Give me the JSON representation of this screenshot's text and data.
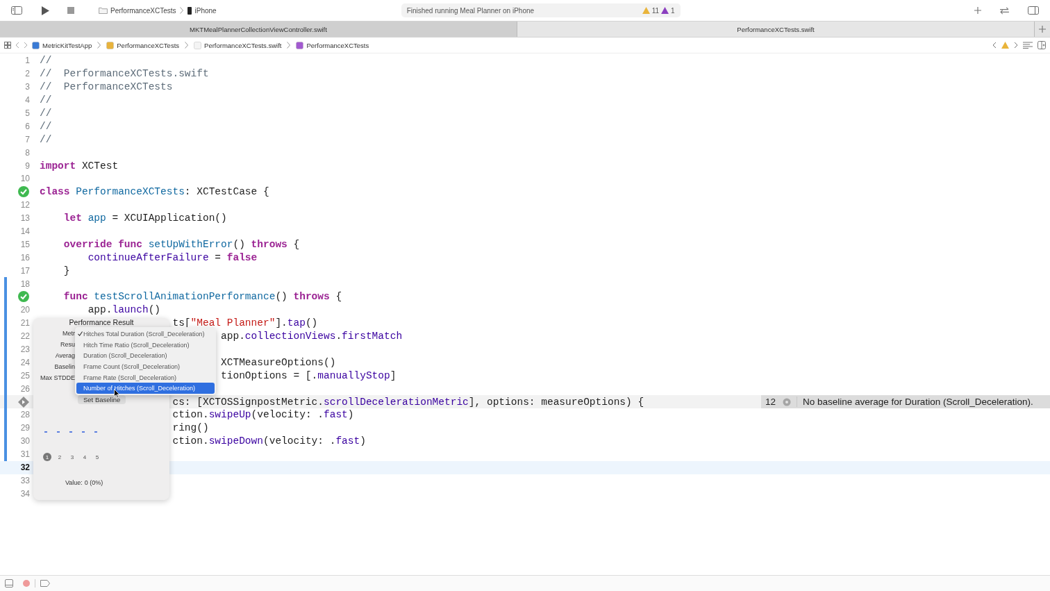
{
  "toolbar": {
    "scheme": "PerformanceXCTests",
    "destination": "iPhone",
    "status": "Finished running Meal Planner on iPhone",
    "warnings": "11",
    "issues": "1"
  },
  "tabs": [
    {
      "label": "MKTMealPlannerCollectionViewController.swift",
      "selected": false
    },
    {
      "label": "PerformanceXCTests.swift",
      "selected": true
    }
  ],
  "breadcrumb": [
    {
      "label": "MetricKitTestApp",
      "kind": "project"
    },
    {
      "label": "PerformanceXCTests",
      "kind": "folder"
    },
    {
      "label": "PerformanceXCTests.swift",
      "kind": "file"
    },
    {
      "label": "PerformanceXCTests",
      "kind": "class"
    }
  ],
  "editor": {
    "lines": [
      {
        "kind": "number",
        "number": "1",
        "changed": false,
        "current": false,
        "tokens": [
          {
            "kind": "comment",
            "text": "//"
          }
        ]
      },
      {
        "kind": "number",
        "number": "2",
        "changed": false,
        "current": false,
        "tokens": [
          {
            "kind": "comment",
            "text": "//  PerformanceXCTests.swift"
          }
        ]
      },
      {
        "kind": "number",
        "number": "3",
        "changed": false,
        "current": false,
        "tokens": [
          {
            "kind": "comment",
            "text": "//  PerformanceXCTests"
          }
        ]
      },
      {
        "kind": "number",
        "number": "4",
        "changed": false,
        "current": false,
        "tokens": [
          {
            "kind": "comment",
            "text": "//"
          }
        ]
      },
      {
        "kind": "number",
        "number": "5",
        "changed": false,
        "current": false,
        "tokens": [
          {
            "kind": "comment",
            "text": "//"
          }
        ]
      },
      {
        "kind": "number",
        "number": "6",
        "changed": false,
        "current": false,
        "tokens": [
          {
            "kind": "comment",
            "text": "//"
          }
        ]
      },
      {
        "kind": "number",
        "number": "7",
        "changed": false,
        "current": false,
        "tokens": [
          {
            "kind": "comment",
            "text": "//"
          }
        ]
      },
      {
        "kind": "number",
        "number": "8",
        "changed": false,
        "current": false
      },
      {
        "kind": "number",
        "number": "9",
        "changed": false,
        "current": false,
        "tokens": [
          {
            "kind": "keyword",
            "text": "import"
          },
          {
            "kind": "plain",
            "text": " XCTest"
          }
        ]
      },
      {
        "kind": "number",
        "number": "10",
        "changed": false,
        "current": false
      },
      {
        "kind": "test_passed",
        "changed": false,
        "current": false,
        "tokens": [
          {
            "kind": "keyword",
            "text": "class "
          },
          {
            "kind": "declaration",
            "text": "PerformanceXCTests"
          },
          {
            "kind": "plain",
            "text": ": XCTestCase {"
          }
        ]
      },
      {
        "kind": "number",
        "number": "12",
        "changed": false,
        "current": false
      },
      {
        "kind": "number",
        "number": "13",
        "changed": false,
        "current": false,
        "tokens": [
          {
            "kind": "keyword",
            "text": "    let "
          },
          {
            "kind": "declaration",
            "text": "app"
          },
          {
            "kind": "plain",
            "text": " = XCUIApplication()"
          }
        ]
      },
      {
        "kind": "number",
        "number": "14",
        "changed": false,
        "current": false
      },
      {
        "kind": "number",
        "number": "15",
        "changed": false,
        "current": false,
        "tokens": [
          {
            "kind": "keyword",
            "text": "    override func "
          },
          {
            "kind": "declaration",
            "text": "setUpWithError"
          },
          {
            "kind": "plain",
            "text": "() "
          },
          {
            "kind": "keyword",
            "text": "throws"
          },
          {
            "kind": "plain",
            "text": " {"
          }
        ]
      },
      {
        "kind": "number",
        "number": "16",
        "changed": false,
        "current": false,
        "tokens": [
          {
            "kind": "member",
            "text": "        continueAfterFailure"
          },
          {
            "kind": "plain",
            "text": " = "
          },
          {
            "kind": "keyword",
            "text": "false"
          }
        ]
      },
      {
        "kind": "number",
        "number": "17",
        "changed": false,
        "current": false,
        "tokens": [
          {
            "kind": "plain",
            "text": "    }"
          }
        ]
      },
      {
        "kind": "number",
        "number": "18",
        "changed": true,
        "current": false
      },
      {
        "kind": "test_passed",
        "changed": true,
        "current": false,
        "tokens": [
          {
            "kind": "keyword",
            "text": "    func "
          },
          {
            "kind": "declaration",
            "text": "testScrollAnimationPerformance"
          },
          {
            "kind": "plain",
            "text": "() "
          },
          {
            "kind": "keyword",
            "text": "throws"
          },
          {
            "kind": "plain",
            "text": " {"
          }
        ]
      },
      {
        "kind": "number",
        "number": "20",
        "changed": true,
        "current": false,
        "tokens": [
          {
            "kind": "plain",
            "text": "        app."
          },
          {
            "kind": "member",
            "text": "launch"
          },
          {
            "kind": "plain",
            "text": "()"
          }
        ]
      },
      {
        "kind": "number",
        "number": "21",
        "changed": true,
        "current": false,
        "tokens": [
          {
            "kind": "plain",
            "text": "                      ts["
          },
          {
            "kind": "string",
            "text": "\"Meal Planner\""
          },
          {
            "kind": "plain",
            "text": "]."
          },
          {
            "kind": "member",
            "text": "tap"
          },
          {
            "kind": "plain",
            "text": "()"
          }
        ]
      },
      {
        "kind": "number",
        "number": "22",
        "changed": true,
        "current": false,
        "tokens": [
          {
            "kind": "plain",
            "text": "                              app."
          },
          {
            "kind": "member",
            "text": "collectionViews"
          },
          {
            "kind": "plain",
            "text": "."
          },
          {
            "kind": "member",
            "text": "firstMatch"
          }
        ]
      },
      {
        "kind": "number",
        "number": "23",
        "changed": true,
        "current": false
      },
      {
        "kind": "number",
        "number": "24",
        "changed": true,
        "current": false,
        "tokens": [
          {
            "kind": "plain",
            "text": "                              XCTMeasureOptions()"
          }
        ]
      },
      {
        "kind": "number",
        "number": "25",
        "changed": true,
        "current": false,
        "tokens": [
          {
            "kind": "plain",
            "text": "                              tionOptions = [."
          },
          {
            "kind": "member",
            "text": "manuallyStop"
          },
          {
            "kind": "plain",
            "text": "]"
          }
        ]
      },
      {
        "kind": "number",
        "number": "26",
        "changed": true,
        "current": false
      },
      {
        "kind": "test_run",
        "changed": true,
        "current": false,
        "highlighted": true,
        "tokens": [
          {
            "kind": "plain",
            "text": "                      cs: [XCTOSSignpostMetric."
          },
          {
            "kind": "member",
            "text": "scrollDecelerationMetric"
          },
          {
            "kind": "plain",
            "text": "], options: measureOptions) {"
          }
        ],
        "annotation": {
          "count": "12",
          "message": "No baseline average for Duration (Scroll_Deceleration)."
        }
      },
      {
        "kind": "number",
        "number": "28",
        "changed": true,
        "current": false,
        "tokens": [
          {
            "kind": "plain",
            "text": "                      ction."
          },
          {
            "kind": "member",
            "text": "swipeUp"
          },
          {
            "kind": "plain",
            "text": "(velocity: ."
          },
          {
            "kind": "member",
            "text": "fast"
          },
          {
            "kind": "plain",
            "text": ")"
          }
        ]
      },
      {
        "kind": "number",
        "number": "29",
        "changed": true,
        "current": false,
        "tokens": [
          {
            "kind": "plain",
            "text": "                      ring()"
          }
        ]
      },
      {
        "kind": "number",
        "number": "30",
        "changed": true,
        "current": false,
        "tokens": [
          {
            "kind": "plain",
            "text": "                      ction."
          },
          {
            "kind": "member",
            "text": "swipeDown"
          },
          {
            "kind": "plain",
            "text": "(velocity: ."
          },
          {
            "kind": "member",
            "text": "fast"
          },
          {
            "kind": "plain",
            "text": ")"
          }
        ]
      },
      {
        "kind": "number",
        "number": "31",
        "changed": true,
        "current": false
      },
      {
        "kind": "number",
        "number": "32",
        "changed": false,
        "current": true
      },
      {
        "kind": "number",
        "number": "33",
        "changed": false,
        "current": false
      },
      {
        "kind": "number",
        "number": "34",
        "changed": false,
        "current": false
      }
    ]
  },
  "performance_popover": {
    "title": "Performance Result",
    "labels": [
      "Metr",
      "Resu",
      "Averag",
      "Baselin",
      "Max STDDE"
    ],
    "button": "Set Baseline",
    "pages": [
      {
        "label": "1",
        "selected": true
      },
      {
        "label": "2",
        "selected": false
      },
      {
        "label": "3",
        "selected": false
      },
      {
        "label": "4",
        "selected": false
      },
      {
        "label": "5",
        "selected": false
      }
    ],
    "value_label": "Value:",
    "value": "0 (0%)"
  },
  "metric_menu": {
    "items": [
      {
        "label": "Hitches Total Duration (Scroll_Deceleration)",
        "checked": true,
        "selected": false
      },
      {
        "label": "Hitch Time Ratio (Scroll_Deceleration)",
        "checked": false,
        "selected": false
      },
      {
        "label": "Duration (Scroll_Deceleration)",
        "checked": false,
        "selected": false
      },
      {
        "label": "Frame Count (Scroll_Deceleration)",
        "checked": false,
        "selected": false
      },
      {
        "label": "Frame Rate (Scroll_Deceleration)",
        "checked": false,
        "selected": false
      },
      {
        "label": "Number of Hitches (Scroll_Deceleration)",
        "checked": false,
        "selected": true
      }
    ]
  }
}
